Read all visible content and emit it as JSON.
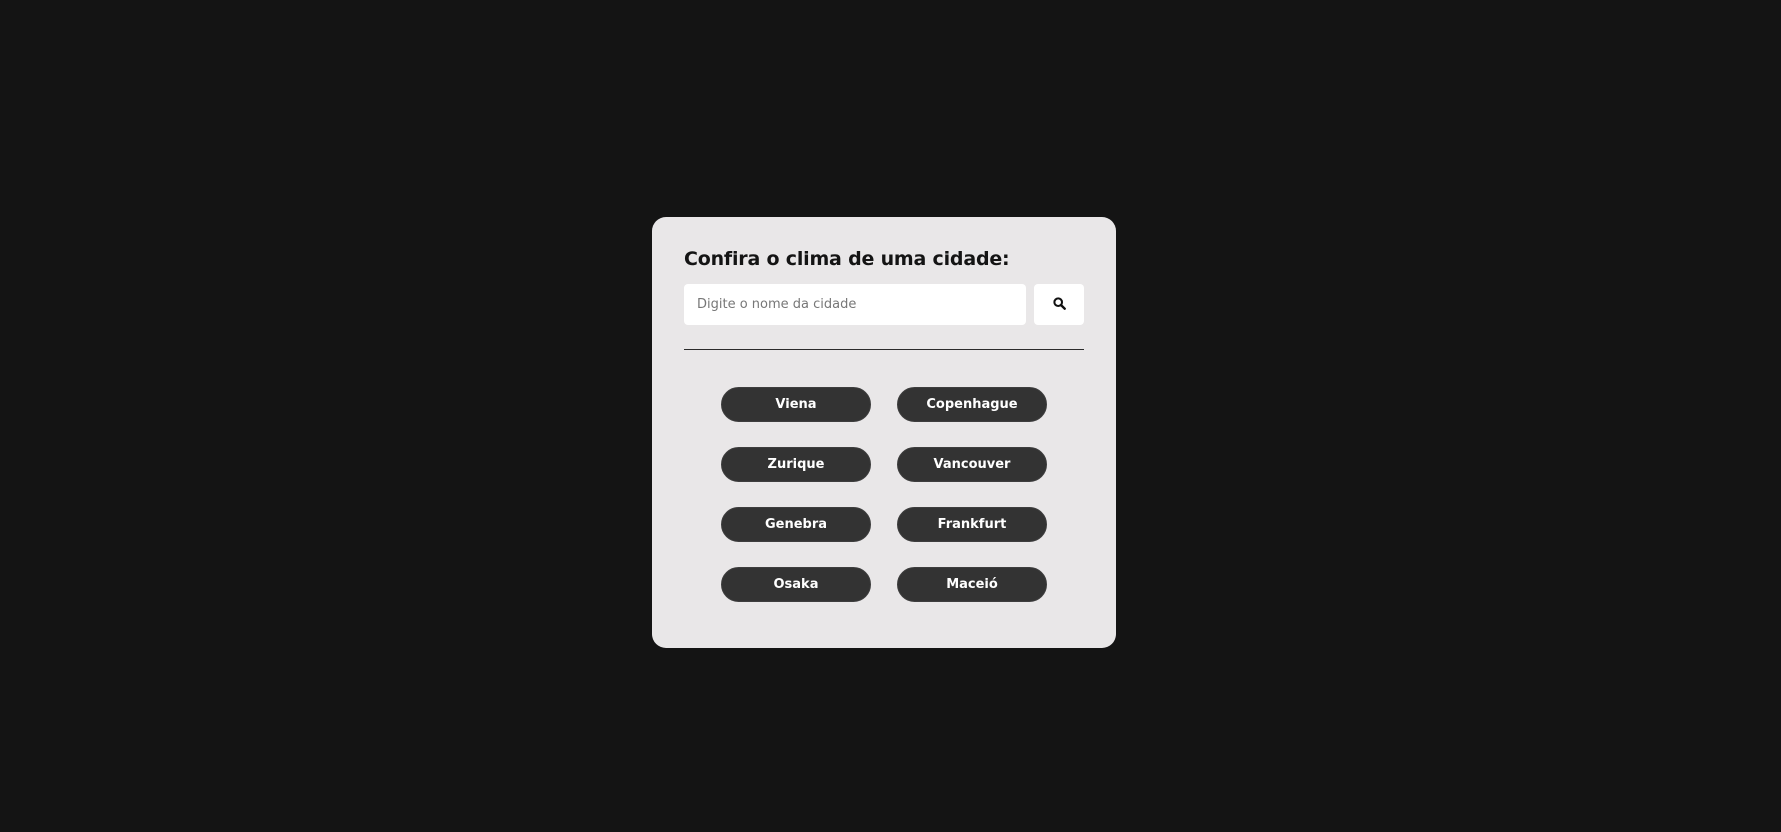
{
  "weather_card": {
    "title": "Confira o clima de uma cidade:",
    "search": {
      "placeholder": "Digite o nome da cidade",
      "value": "",
      "button_icon": "search-icon"
    },
    "cities": [
      {
        "label": "Viena"
      },
      {
        "label": "Copenhague"
      },
      {
        "label": "Zurique"
      },
      {
        "label": "Vancouver"
      },
      {
        "label": "Genebra"
      },
      {
        "label": "Frankfurt"
      },
      {
        "label": "Osaka"
      },
      {
        "label": "Maceió"
      }
    ]
  },
  "colors": {
    "background": "#141414",
    "card": "#e9e7e8",
    "button": "#333333",
    "button_text": "#ffffff"
  }
}
